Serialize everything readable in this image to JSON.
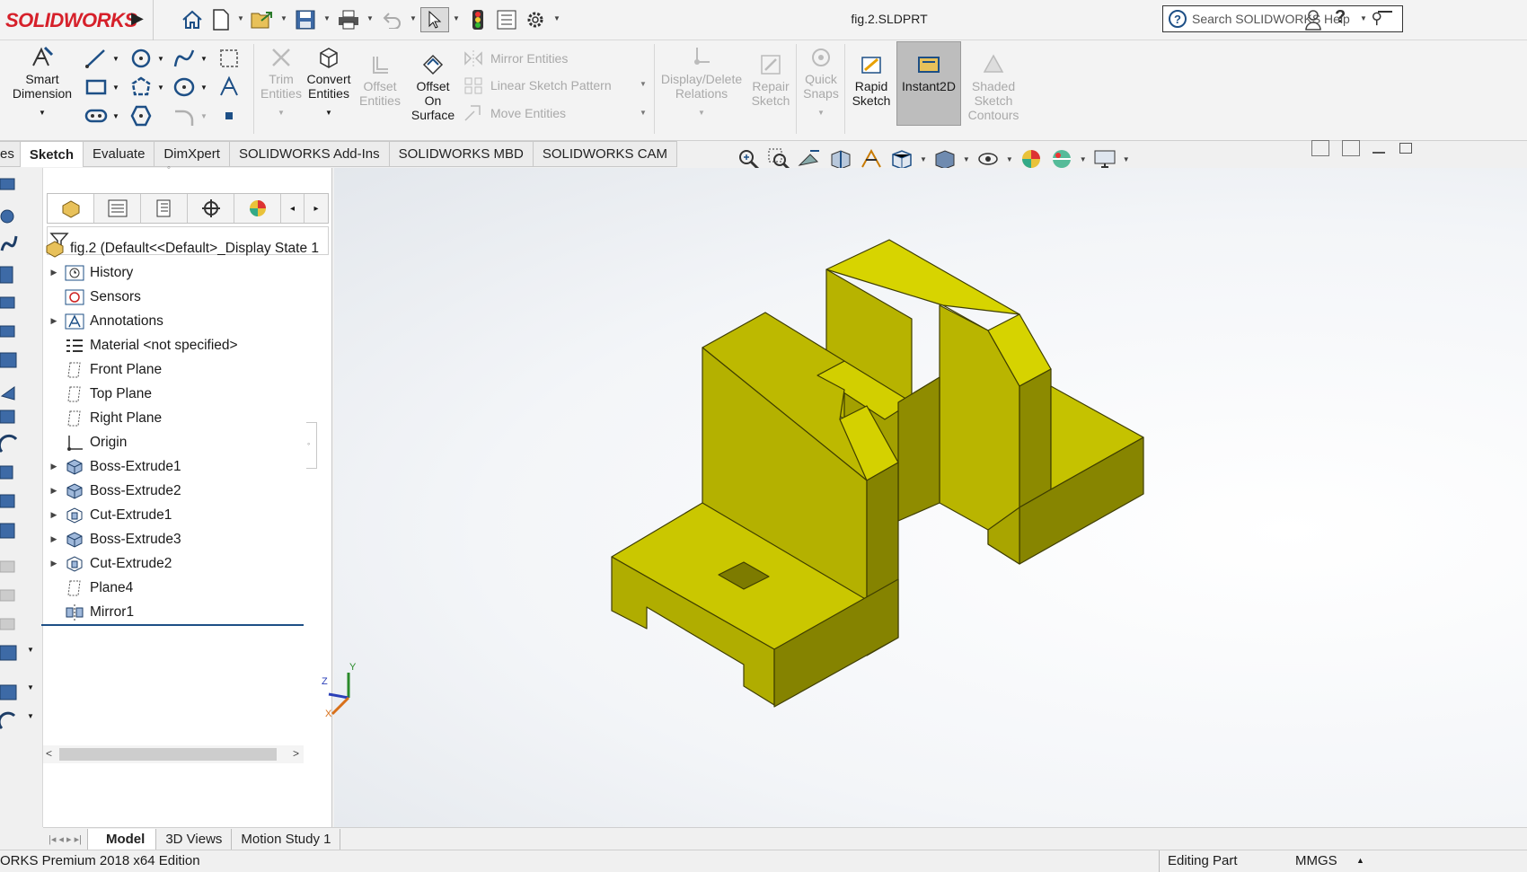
{
  "app": {
    "logo": "SOLIDWORKS",
    "document_title": "fig.2.SLDPRT",
    "search_placeholder": "Search SOLIDWORKS Help"
  },
  "ribbon": {
    "smart_dimension": [
      "Smart",
      "Dimension"
    ],
    "trim_entities": [
      "Trim",
      "Entities"
    ],
    "convert_entities": [
      "Convert",
      "Entities"
    ],
    "offset_entities": [
      "Offset",
      "Entities"
    ],
    "offset_on_surface": [
      "Offset",
      "On",
      "Surface"
    ],
    "mirror_entities": "Mirror Entities",
    "linear_sketch_pattern": "Linear Sketch Pattern",
    "move_entities": "Move Entities",
    "display_delete_relations": [
      "Display/Delete",
      "Relations"
    ],
    "repair_sketch": [
      "Repair",
      "Sketch"
    ],
    "quick_snaps": [
      "Quick",
      "Snaps"
    ],
    "rapid_sketch": [
      "Rapid",
      "Sketch"
    ],
    "instant2d": "Instant2D",
    "shaded_sketch_contours": [
      "Shaded",
      "Sketch",
      "Contours"
    ]
  },
  "tabs": [
    "es",
    "Sketch",
    "Evaluate",
    "DimXpert",
    "SOLIDWORKS Add-Ins",
    "SOLIDWORKS MBD",
    "SOLIDWORKS CAM"
  ],
  "active_tab": "Sketch",
  "tree": {
    "root": "fig.2  (Default<<Default>_Display State 1",
    "items": [
      {
        "label": "History",
        "icon": "history-icon",
        "expandable": true
      },
      {
        "label": "Sensors",
        "icon": "sensors-icon",
        "expandable": false
      },
      {
        "label": "Annotations",
        "icon": "annotations-icon",
        "expandable": true
      },
      {
        "label": "Material <not specified>",
        "icon": "material-icon",
        "expandable": false
      },
      {
        "label": "Front Plane",
        "icon": "plane-icon",
        "expandable": false
      },
      {
        "label": "Top Plane",
        "icon": "plane-icon",
        "expandable": false
      },
      {
        "label": "Right Plane",
        "icon": "plane-icon",
        "expandable": false
      },
      {
        "label": "Origin",
        "icon": "origin-icon",
        "expandable": false
      },
      {
        "label": "Boss-Extrude1",
        "icon": "extrude-icon",
        "expandable": true
      },
      {
        "label": "Boss-Extrude2",
        "icon": "extrude-icon",
        "expandable": true
      },
      {
        "label": "Cut-Extrude1",
        "icon": "cut-icon",
        "expandable": true
      },
      {
        "label": "Boss-Extrude3",
        "icon": "extrude-icon",
        "expandable": true
      },
      {
        "label": "Cut-Extrude2",
        "icon": "cut-icon",
        "expandable": true
      },
      {
        "label": "Plane4",
        "icon": "plane-icon",
        "expandable": false
      },
      {
        "label": "Mirror1",
        "icon": "mirror-icon",
        "expandable": false
      }
    ]
  },
  "bottom_tabs": [
    "Model",
    "3D Views",
    "Motion Study 1"
  ],
  "active_bottom_tab": "Model",
  "status": {
    "edition": "ORKS Premium 2018 x64 Edition",
    "mode": "Editing Part",
    "units": "MMGS"
  },
  "triad": {
    "x": "X",
    "y": "Y",
    "z": "Z"
  },
  "colors": {
    "part": "#c5c200",
    "part_dark": "#8c8a00",
    "logo": "#d6202a"
  }
}
